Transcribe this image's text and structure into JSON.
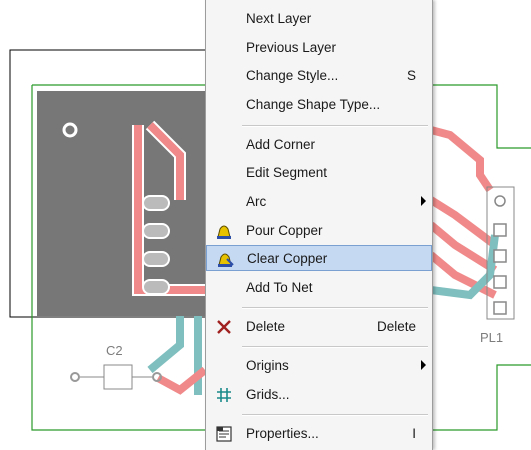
{
  "pcb": {
    "component_c2": "C2",
    "component_pl1": "PL1"
  },
  "menu": {
    "items": [
      {
        "label": "Next Layer",
        "shortcut": ""
      },
      {
        "label": "Previous Layer",
        "shortcut": ""
      },
      {
        "label": "Change Style...",
        "shortcut": "S"
      },
      {
        "label": "Change Shape Type...",
        "shortcut": ""
      },
      {
        "label": "Add Corner",
        "shortcut": ""
      },
      {
        "label": "Edit Segment",
        "shortcut": ""
      },
      {
        "label": "Arc",
        "shortcut": ""
      },
      {
        "label": "Pour Copper",
        "shortcut": ""
      },
      {
        "label": "Clear Copper",
        "shortcut": ""
      },
      {
        "label": "Add To Net",
        "shortcut": ""
      },
      {
        "label": "Delete",
        "shortcut": "Delete"
      },
      {
        "label": "Origins",
        "shortcut": ""
      },
      {
        "label": "Grids...",
        "shortcut": ""
      },
      {
        "label": "Properties...",
        "shortcut": "I"
      }
    ],
    "highlighted": "Clear Copper"
  },
  "icons": [
    "bell-copper-icon",
    "bell-clear-icon",
    "delete-x-icon",
    "grid-icon",
    "properties-icon"
  ]
}
